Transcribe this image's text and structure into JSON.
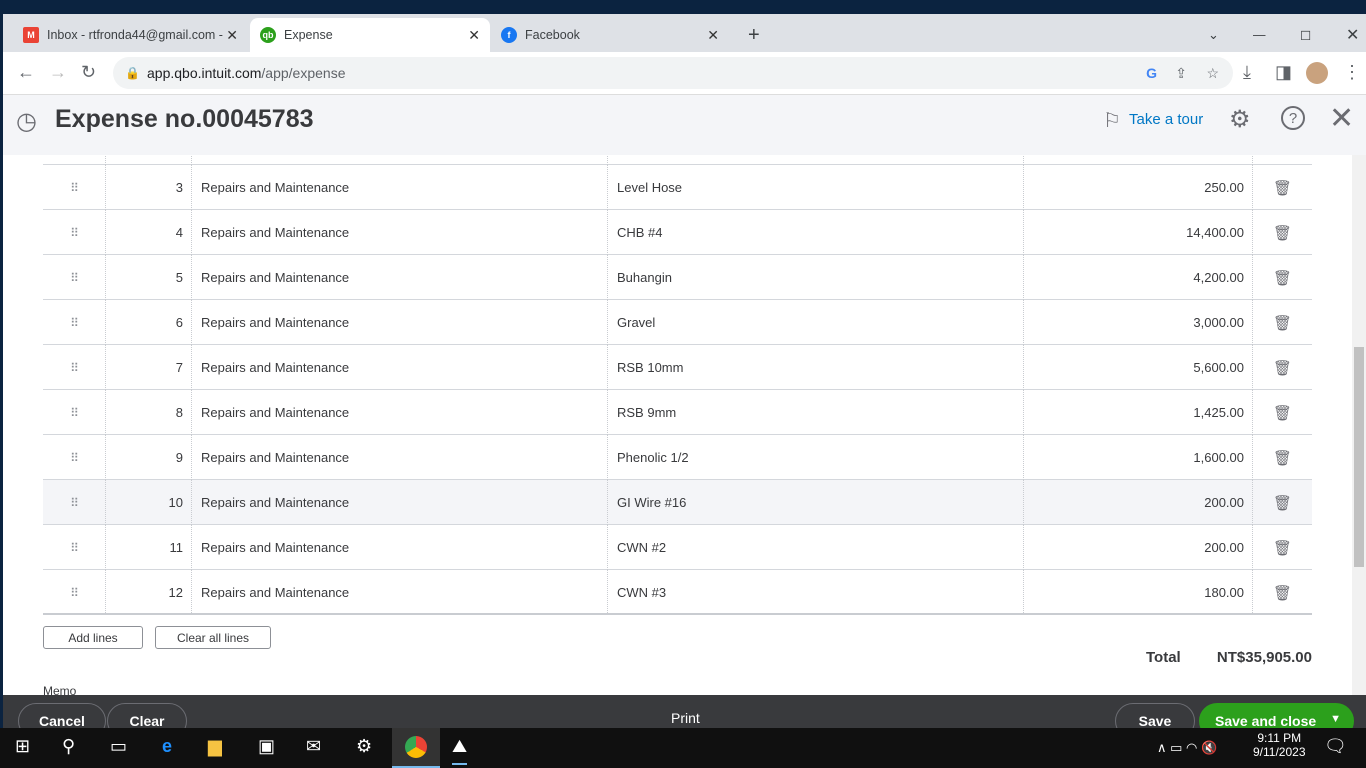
{
  "browser": {
    "tabs": [
      {
        "label": "Inbox - rtfronda44@gmail.com - ",
        "icon": "gmail-icon"
      },
      {
        "label": "Expense",
        "icon": "quickbooks-icon"
      },
      {
        "label": "Facebook",
        "icon": "facebook-icon"
      }
    ],
    "url_host": "app.qbo.intuit.com",
    "url_path": "/app/expense"
  },
  "header": {
    "title": "Expense no.00045783",
    "tour": "Take a tour"
  },
  "table": {
    "rows": [
      {
        "n": "3",
        "account": "Repairs and Maintenance",
        "desc": "Level Hose",
        "amount": "250.00"
      },
      {
        "n": "4",
        "account": "Repairs and Maintenance",
        "desc": "CHB #4",
        "amount": "14,400.00"
      },
      {
        "n": "5",
        "account": "Repairs and Maintenance",
        "desc": "Buhangin",
        "amount": "4,200.00"
      },
      {
        "n": "6",
        "account": "Repairs and Maintenance",
        "desc": "Gravel",
        "amount": "3,000.00"
      },
      {
        "n": "7",
        "account": "Repairs and Maintenance",
        "desc": "RSB 10mm",
        "amount": "5,600.00"
      },
      {
        "n": "8",
        "account": "Repairs and Maintenance",
        "desc": "RSB 9mm",
        "amount": "1,425.00"
      },
      {
        "n": "9",
        "account": "Repairs and Maintenance",
        "desc": "Phenolic 1/2",
        "amount": "1,600.00"
      },
      {
        "n": "10",
        "account": "Repairs and Maintenance",
        "desc": "GI Wire #16",
        "amount": "200.00"
      },
      {
        "n": "11",
        "account": "Repairs and Maintenance",
        "desc": "CWN #2",
        "amount": "200.00"
      },
      {
        "n": "12",
        "account": "Repairs and Maintenance",
        "desc": "CWN #3",
        "amount": "180.00"
      }
    ]
  },
  "actions": {
    "add_lines": "Add lines",
    "clear_all": "Clear all lines"
  },
  "total": {
    "label": "Total",
    "value": "NT$35,905.00"
  },
  "memo_label": "Memo",
  "footer": {
    "cancel": "Cancel",
    "clear": "Clear",
    "print": "Print",
    "save": "Save",
    "save_close": "Save and close"
  },
  "taskbar": {
    "time": "9:11 PM",
    "date": "9/11/2023"
  }
}
